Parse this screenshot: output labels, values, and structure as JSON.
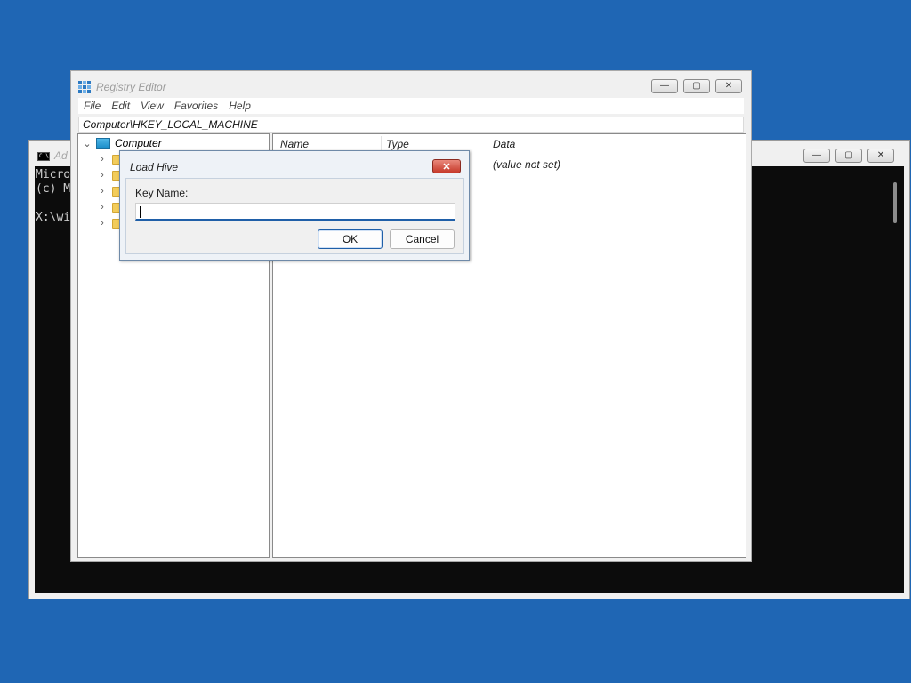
{
  "cmd": {
    "title": "Ad",
    "icon_text": "C:\\",
    "lines": [
      "Micro",
      "(c) M",
      "",
      "X:\\wi"
    ]
  },
  "regedit": {
    "title": "Registry Editor",
    "menu": [
      "File",
      "Edit",
      "View",
      "Favorites",
      "Help"
    ],
    "address": "Computer\\HKEY_LOCAL_MACHINE",
    "tree": {
      "root_label": "Computer",
      "child_count_folders": 5
    },
    "columns": {
      "name": "Name",
      "type": "Type",
      "data": "Data"
    },
    "default_value_data": "(value not set)"
  },
  "dialog": {
    "title": "Load Hive",
    "key_label": "Key Name:",
    "key_value": "",
    "ok_label": "OK",
    "cancel_label": "Cancel",
    "close_glyph": "✕"
  },
  "caption": {
    "minimize": "—",
    "maximize": "▢",
    "close": "✕"
  }
}
